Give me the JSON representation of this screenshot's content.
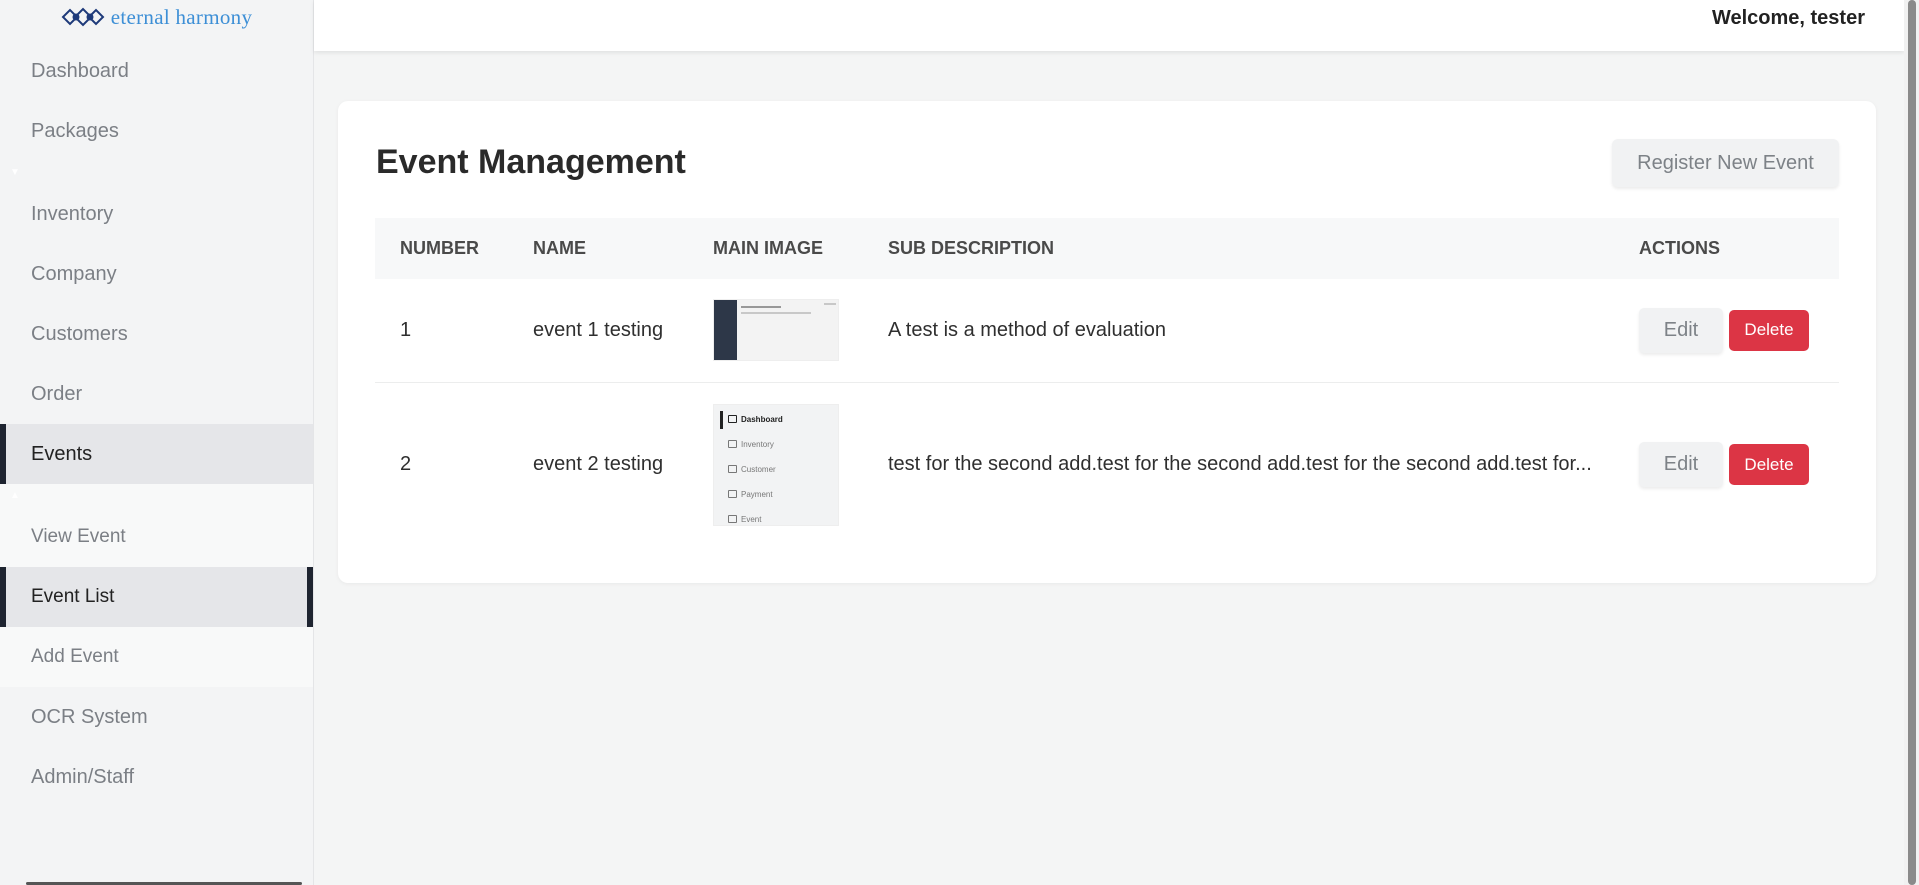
{
  "brand": {
    "logo_text": "eternal harmony",
    "accent": "#3d8fd6"
  },
  "header": {
    "welcome": "Welcome, tester"
  },
  "sidebar": {
    "items_top": [
      {
        "label": "Dashboard"
      },
      {
        "label": "Packages"
      }
    ],
    "items_mid": [
      {
        "label": "Inventory"
      },
      {
        "label": "Company"
      },
      {
        "label": "Customers"
      },
      {
        "label": "Order"
      },
      {
        "label": "Events",
        "active": true
      }
    ],
    "events_sub": [
      {
        "label": "View Event"
      },
      {
        "label": "Event List",
        "active": true
      },
      {
        "label": "Add Event"
      }
    ],
    "items_bottom": [
      {
        "label": "OCR System"
      },
      {
        "label": "Admin/Staff"
      }
    ]
  },
  "main": {
    "title": "Event Management",
    "register_label": "Register New Event",
    "columns": [
      "NUMBER",
      "NAME",
      "MAIN IMAGE",
      "SUB DESCRIPTION",
      "ACTIONS"
    ],
    "rows": [
      {
        "number": "1",
        "name": "event 1 testing",
        "image": "screenshot-thumbnail",
        "description": "A test is a method of evaluation",
        "edit_label": "Edit",
        "delete_label": "Delete"
      },
      {
        "number": "2",
        "name": "event 2 testing",
        "image": "menu-thumbnail",
        "description": "test for the second add.test for the second add.test for the second add.test for...",
        "edit_label": "Edit",
        "delete_label": "Delete"
      }
    ],
    "thumb2_menu": [
      "Dashboard",
      "Inventory",
      "Customer",
      "Payment",
      "Event"
    ]
  },
  "colors": {
    "delete": "#dc3545",
    "active_bar": "#1e2430"
  }
}
